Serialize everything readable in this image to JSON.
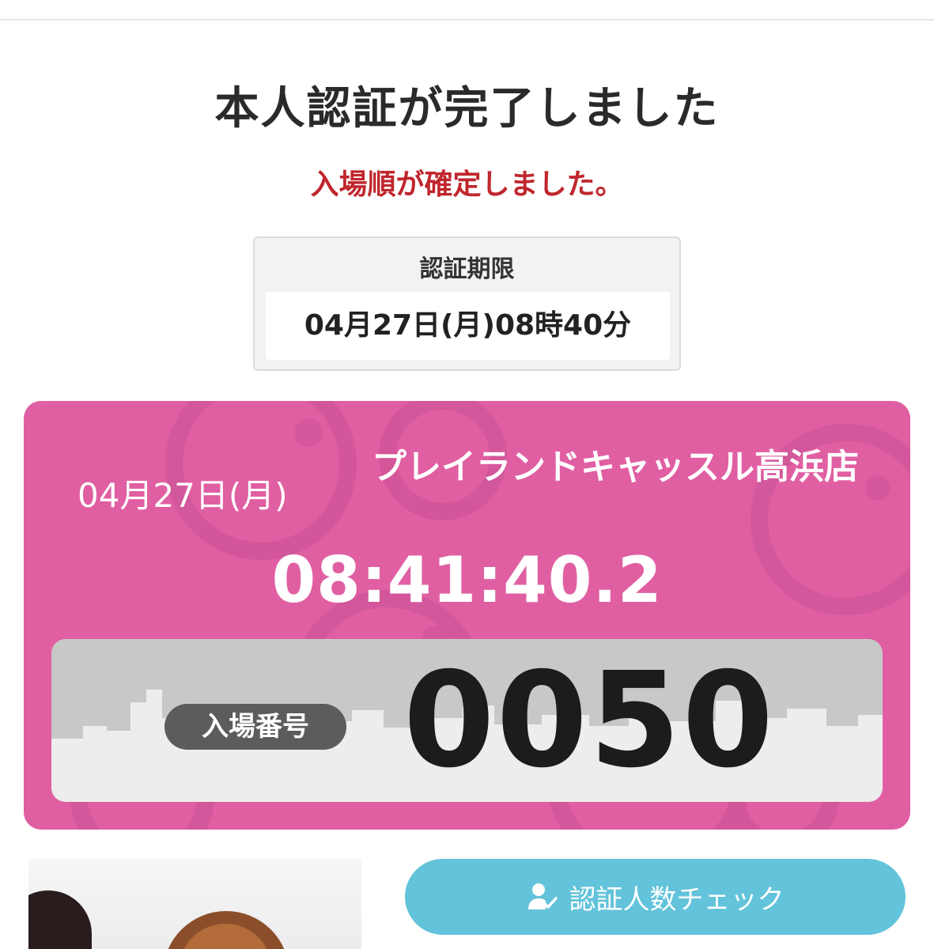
{
  "page": {
    "title": "本人認証が完了しました",
    "subtitle": "入場順が確定しました。"
  },
  "deadline": {
    "label": "認証期限",
    "value": "04月27日(月)08時40分"
  },
  "ticket": {
    "date": "04月27日(月)",
    "store": "プレイランドキャッスル高浜店",
    "time": "08:41:40.2",
    "entry_label": "入場番号",
    "entry_number": "0050"
  },
  "actions": {
    "check_button_label": "認証人数チェック",
    "check_button_icon": "user-check-icon"
  },
  "colors": {
    "title": "#2a2a2a",
    "subtitle": "#c0262d",
    "ticket_bg": "#e05fa2",
    "number_panel_bg": "#c8c8c8",
    "entry_label_bg": "#5c5c5c",
    "button_bg": "#62c3da"
  }
}
